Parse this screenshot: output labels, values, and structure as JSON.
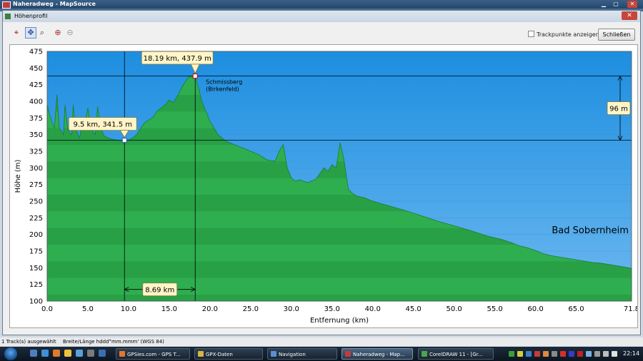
{
  "window": {
    "title": "Naheradweg - MapSource"
  },
  "dialog": {
    "title": "Höhenprofil",
    "trackpoints_label": "Trackpunkte anzeigen",
    "close_label": "Schließen",
    "close_glyph": "✕"
  },
  "chart_data": {
    "type": "area",
    "xlabel": "Entfernung   (km)",
    "ylabel": "Höhe (m)",
    "xlim": [
      0,
      71.8
    ],
    "ylim": [
      100,
      475
    ],
    "x_ticks": [
      "0.0",
      "5.0",
      "10.0",
      "15.0",
      "20.0",
      "25.0",
      "30.0",
      "35.0",
      "40.0",
      "45.0",
      "50.0",
      "55.0",
      "60.0",
      "65.0",
      "71.8"
    ],
    "y_ticks": [
      "475",
      "450",
      "425",
      "400",
      "375",
      "350",
      "325",
      "300",
      "275",
      "250",
      "225",
      "200",
      "175",
      "150",
      "125",
      "100"
    ],
    "colors": {
      "sky": "#6cb8f0",
      "terrain": "#2fae4f",
      "terrain_dark": "#1f7a33",
      "line": "#000000",
      "callout_bg": "#fff5c8"
    },
    "series": [
      {
        "x": [
          0.0,
          0.3,
          0.6,
          0.9,
          1.2,
          1.5,
          1.8,
          2.0,
          2.2,
          2.5,
          2.8,
          3.0,
          3.2,
          3.5,
          3.8,
          4.0,
          4.3,
          4.6,
          5.0,
          5.3,
          5.6,
          5.9,
          6.2,
          6.6,
          7.0,
          7.5,
          8.0,
          8.5,
          9.0,
          9.5,
          10.0,
          10.5,
          11.0,
          11.5,
          12.0,
          12.5,
          13.0,
          13.5,
          14.0,
          14.5,
          15.0,
          15.5,
          16.0,
          16.5,
          17.0,
          17.5,
          18.19,
          18.6,
          19.0,
          19.5,
          20.0,
          20.5,
          21.0,
          22.0,
          23.0,
          24.0,
          25.0,
          26.0,
          27.0,
          28.0,
          28.5,
          29.0,
          29.5,
          30.0,
          30.5,
          31.0,
          32.0,
          33.0,
          34.0,
          34.5,
          35.0,
          35.5,
          36.0,
          36.5,
          37.0,
          37.5,
          38.0,
          39.0,
          40.0,
          42.0,
          44.0,
          46.0,
          48.0,
          50.0,
          52.0,
          54.0,
          56.0,
          57.0,
          58.0,
          59.0,
          60.0,
          61.0,
          62.0,
          63.0,
          64.0,
          65.0,
          66.0,
          67.0,
          68.0,
          69.0,
          70.0,
          71.0,
          71.8
        ],
        "y": [
          395,
          380,
          368,
          360,
          410,
          360,
          355,
          350,
          395,
          360,
          352,
          350,
          395,
          360,
          350,
          345,
          372,
          365,
          390,
          365,
          355,
          350,
          392,
          360,
          348,
          345,
          343,
          342,
          340,
          341.5,
          342,
          345,
          350,
          360,
          368,
          372,
          376,
          385,
          390,
          395,
          402,
          398,
          408,
          420,
          430,
          438,
          437.9,
          420,
          400,
          385,
          370,
          360,
          350,
          340,
          335,
          330,
          325,
          320,
          312,
          310,
          325,
          335,
          300,
          285,
          280,
          282,
          278,
          283,
          300,
          295,
          305,
          300,
          338,
          310,
          268,
          262,
          258,
          255,
          250,
          243,
          236,
          228,
          220,
          213,
          206,
          198,
          192,
          188,
          183,
          180,
          176,
          171,
          168,
          166,
          164,
          162,
          160,
          158,
          157,
          155,
          153,
          151,
          149
        ]
      }
    ],
    "annotations": [
      {
        "text": "18.19 km, 437.9 m",
        "x": 18.19,
        "y": 437.9
      },
      {
        "text": "9.5 km, 341.5 m",
        "x": 9.5,
        "y": 341.5
      }
    ],
    "measure_x": "8.69 km",
    "measure_y": "96 m",
    "place_labels": [
      {
        "text": "Schmissberg (Birkenfeld)",
        "x": 19.5,
        "y": 426
      },
      {
        "text": "Bad Sobernheim",
        "x": 62.0,
        "y": 202
      }
    ]
  },
  "statusbar": {
    "tracks": "1 Track(s) ausgewählt",
    "format": "Breite/Länge hddd°mm.mmm' (WGS 84)"
  },
  "taskbar": {
    "items": [
      {
        "label": "GPSies.com - GPS T...",
        "color": "#e8742a"
      },
      {
        "label": "GPX-Daten",
        "color": "#d8b440"
      },
      {
        "label": "Navigation",
        "color": "#5a8fd0"
      },
      {
        "label": "Naheradweg - Map...",
        "color": "#c23b3b"
      },
      {
        "label": "CorelDRAW 11 - [Gr...",
        "color": "#49a54d"
      }
    ],
    "clock": "22:14"
  }
}
